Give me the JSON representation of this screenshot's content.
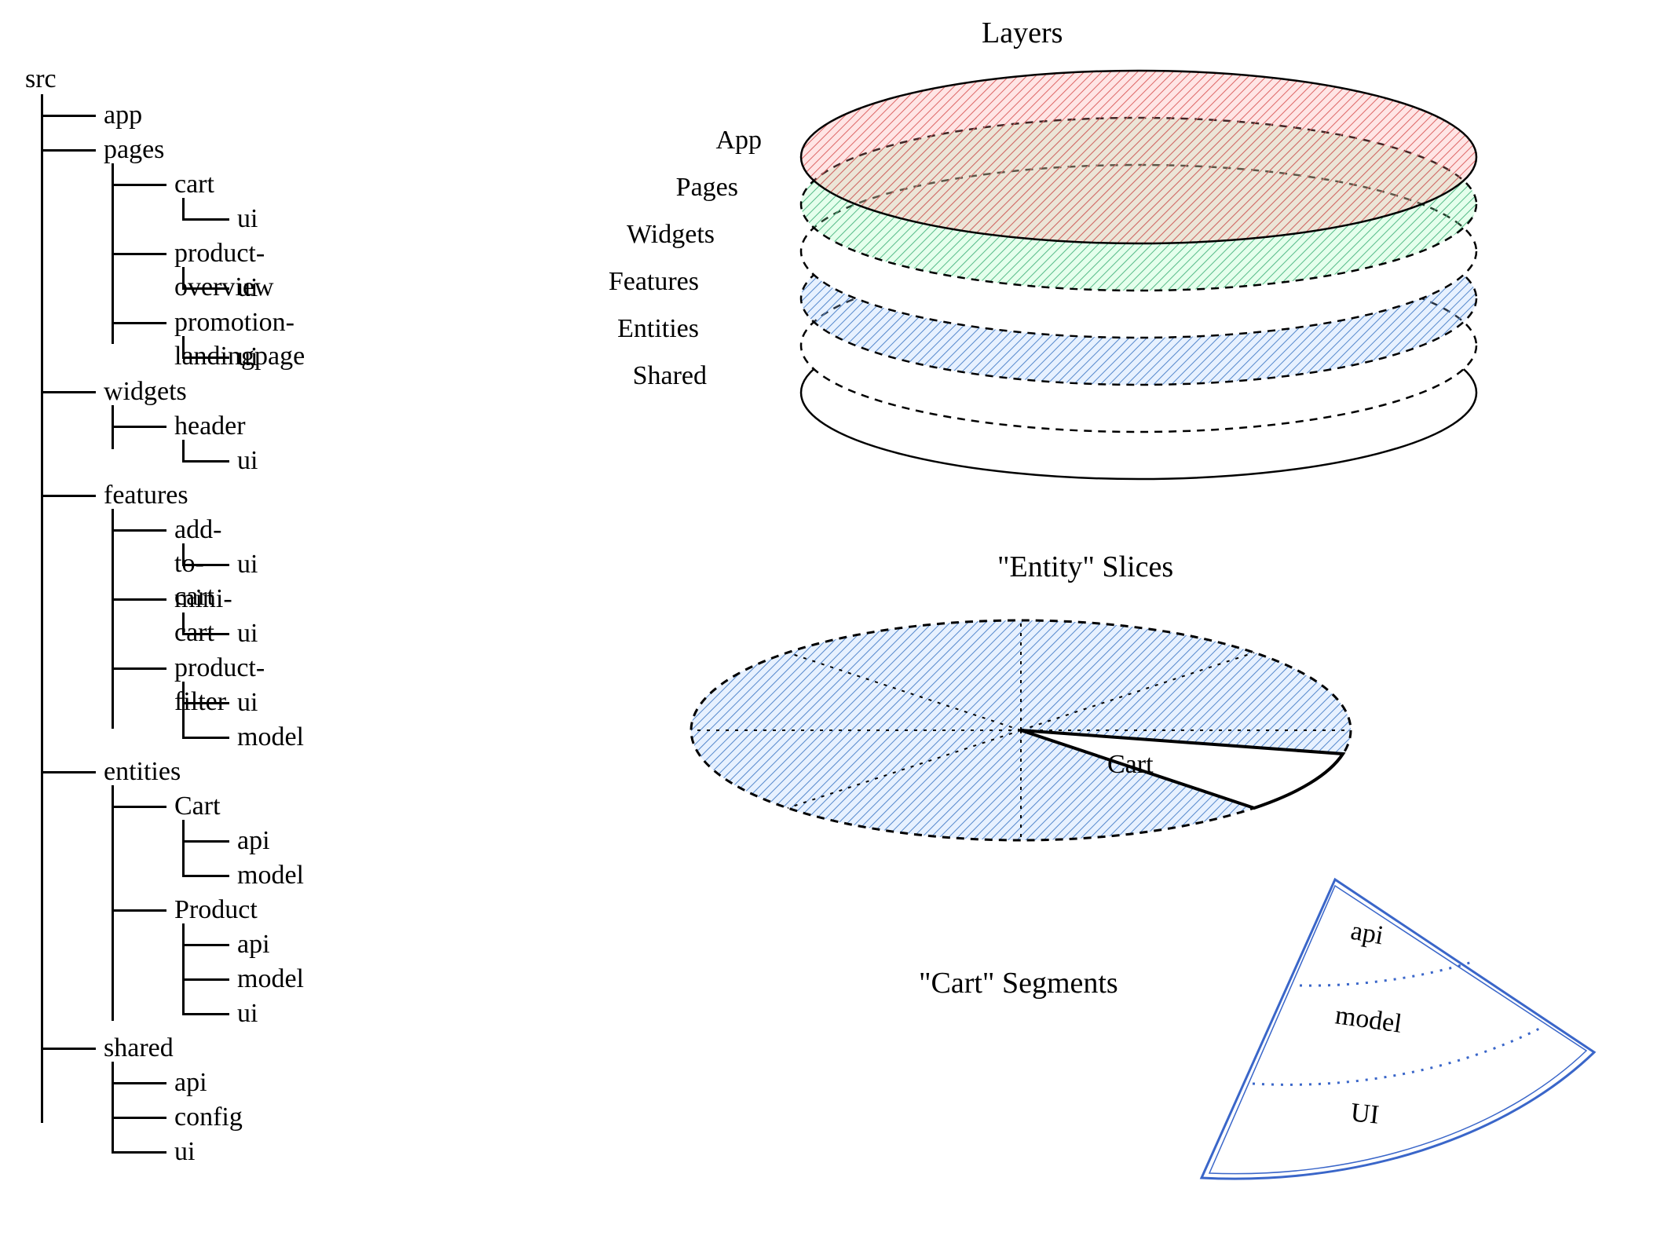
{
  "tree": {
    "root": "src",
    "app": "app",
    "pages": "pages",
    "pages_cart": "cart",
    "pages_cart_ui": "ui",
    "pages_product_overview": "product-overview",
    "pages_product_overview_ui": "ui",
    "pages_promo": "promotion-landingpage",
    "pages_promo_ui": "ui",
    "widgets": "widgets",
    "widgets_header": "header",
    "widgets_header_ui": "ui",
    "features": "features",
    "features_add_to_cart": "add-to-cart",
    "features_add_to_cart_ui": "ui",
    "features_mini_cart": "mini-cart",
    "features_mini_cart_ui": "ui",
    "features_product_filter": "product-filter",
    "features_product_filter_ui": "ui",
    "features_product_filter_model": "model",
    "entities": "entities",
    "entities_cart": "Cart",
    "entities_cart_api": "api",
    "entities_cart_model": "model",
    "entities_product": "Product",
    "entities_product_api": "api",
    "entities_product_model": "model",
    "entities_product_ui": "ui",
    "shared": "shared",
    "shared_api": "api",
    "shared_config": "config",
    "shared_ui": "ui"
  },
  "layers": {
    "title": "Layers",
    "app": "App",
    "pages": "Pages",
    "widgets": "Widgets",
    "features": "Features",
    "entities": "Entities",
    "shared": "Shared"
  },
  "slices": {
    "title": "\"Entity\" Slices",
    "cart": "Cart"
  },
  "segments": {
    "title": "\"Cart\" Segments",
    "api": "api",
    "model": "model",
    "ui": "UI"
  }
}
